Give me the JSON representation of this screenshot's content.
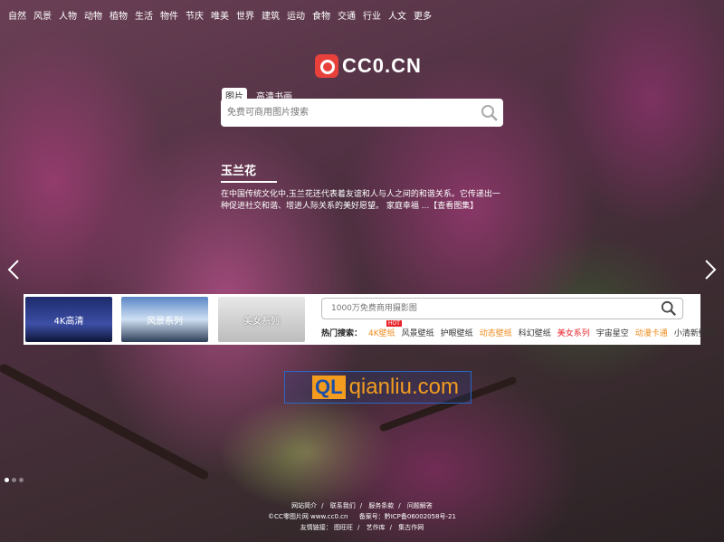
{
  "nav": [
    "自然",
    "风景",
    "人物",
    "动物",
    "植物",
    "生活",
    "物件",
    "节庆",
    "唯美",
    "世界",
    "建筑",
    "运动",
    "食物",
    "交通",
    "行业",
    "人文",
    "更多"
  ],
  "logo_text": "CC0.CN",
  "search_tabs": [
    "图片",
    "高清书画"
  ],
  "main_search": {
    "placeholder": "免费可商用图片搜索"
  },
  "feature": {
    "title": "玉兰花",
    "description": "在中国传统文化中,玉兰花还代表着友谊和人与人之间的和谐关系。它传递出一种促进社交和谐、增进人际关系的美好愿望。 家庭幸福 ...【查看图集】"
  },
  "band": {
    "thumbs": [
      "4K高清",
      "风景系列",
      "美女系列"
    ],
    "search_placeholder": "1000万免费商用摄影图",
    "hot_label": "热门搜索：",
    "hot_badge": "HOT",
    "hot_items": [
      "4K壁纸",
      "风景壁纸",
      "护眼壁纸",
      "动态壁纸",
      "科幻壁纸",
      "美女系列",
      "宇宙星空",
      "动漫卡通",
      "小清新壁纸"
    ]
  },
  "watermark": {
    "badge": "QL",
    "text": "qianliu.com"
  },
  "footer": {
    "links": [
      "网站简介",
      "联系我们",
      "服务条款",
      "问题解答"
    ],
    "copyright": "©CC零图片网 www.cc0.cn",
    "icp": "备案号：黔ICP备06002058号-21",
    "friend_label": "友情链接：",
    "friend_links": [
      "图旺旺",
      "艺作库",
      "集古作网"
    ]
  },
  "colors": {
    "accent": "#e8413b",
    "hot_orange": "#ef8a1b",
    "hot_red": "#e8242b"
  }
}
